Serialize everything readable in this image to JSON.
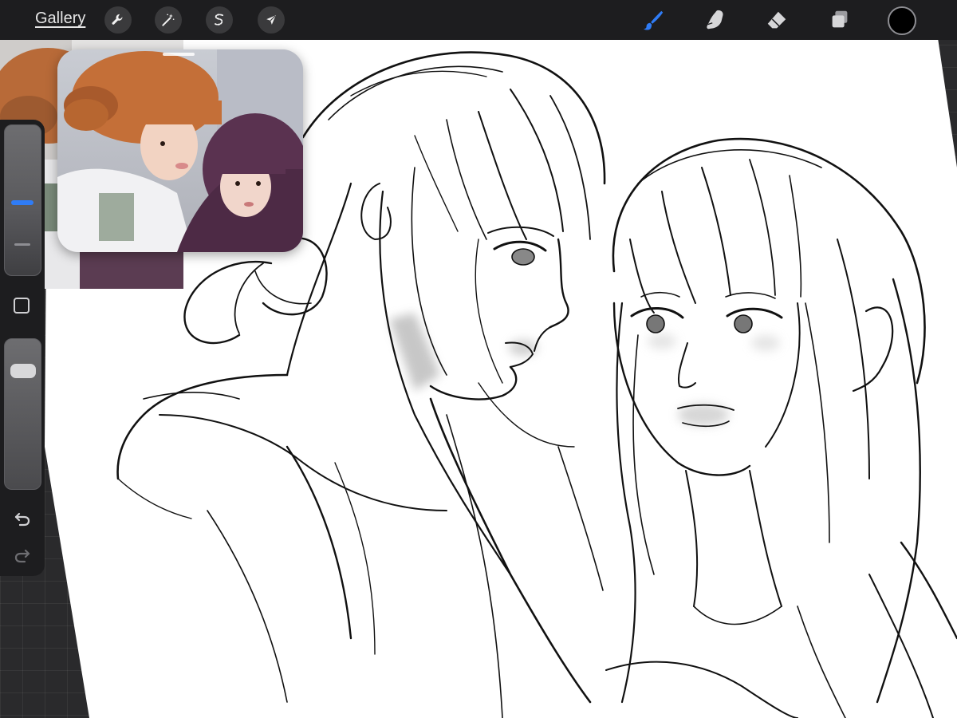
{
  "toolbar": {
    "gallery_label": "Gallery",
    "actions_icon": "wrench-icon",
    "adjustments_icon": "magic-wand-icon",
    "selection_icon": "selection-s-icon",
    "transform_icon": "arrow-cursor-icon",
    "brush_icon": "brush-icon",
    "smudge_icon": "smudge-icon",
    "eraser_icon": "eraser-icon",
    "layers_icon": "layers-icon",
    "active_tool": "brush",
    "current_color": "#000000",
    "accent_color": "#2f7cf6"
  },
  "sidebar": {
    "brush_size_level": 0.45,
    "opacity_level": 0.82,
    "modify_button_icon": "square-icon",
    "undo_icon": "undo-arrow-icon",
    "redo_icon": "redo-arrow-icon"
  },
  "reference": {
    "description_icon": "reference-photo"
  }
}
